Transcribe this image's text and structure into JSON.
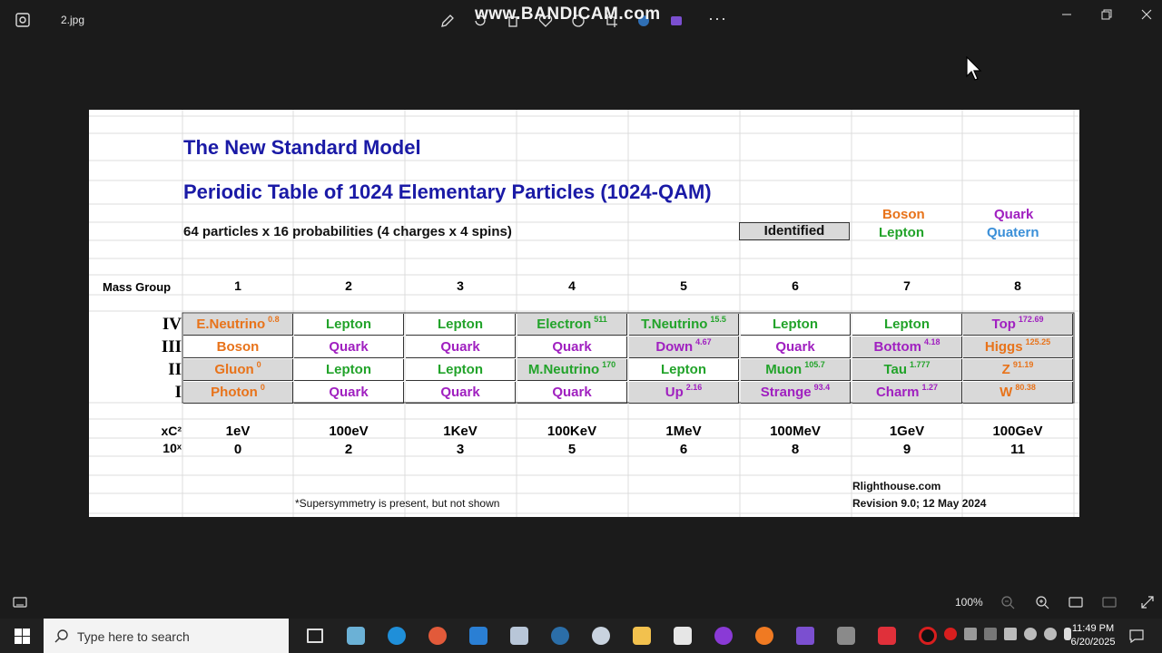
{
  "viewer": {
    "filename": "2.jpg",
    "watermark": "www.BANDICAM.com",
    "more_label": "···",
    "zoom": "100%"
  },
  "sheet": {
    "title": "The New Standard Model",
    "subtitle": "Periodic Table of 1024 Elementary Particles (1024-QAM)",
    "description": "64 particles x 16 probabilities (4 charges x 4 spins)",
    "identified_label": "Identified",
    "legend": {
      "boson": "Boson",
      "lepton": "Lepton",
      "quark": "Quark",
      "quatern": "Quatern"
    },
    "mass_group_label": "Mass Group",
    "mass_groups": [
      "1",
      "2",
      "3",
      "4",
      "5",
      "6",
      "7",
      "8"
    ],
    "generations": [
      "IV",
      "III",
      "II",
      "I"
    ],
    "rows": [
      [
        {
          "name": "E.Neutrino",
          "sup": "0.8",
          "type": "boson",
          "shade": true
        },
        {
          "name": "Lepton",
          "sup": "",
          "type": "lepton",
          "shade": false
        },
        {
          "name": "Lepton",
          "sup": "",
          "type": "lepton",
          "shade": false
        },
        {
          "name": "Electron",
          "sup": "511",
          "type": "lepton",
          "shade": true
        },
        {
          "name": "T.Neutrino",
          "sup": "15.5",
          "type": "lepton",
          "shade": true
        },
        {
          "name": "Lepton",
          "sup": "",
          "type": "lepton",
          "shade": false
        },
        {
          "name": "Lepton",
          "sup": "",
          "type": "lepton",
          "shade": false
        },
        {
          "name": "Top",
          "sup": "172.69",
          "type": "quark",
          "shade": true
        }
      ],
      [
        {
          "name": "Boson",
          "sup": "",
          "type": "boson",
          "shade": false
        },
        {
          "name": "Quark",
          "sup": "",
          "type": "quark",
          "shade": false
        },
        {
          "name": "Quark",
          "sup": "",
          "type": "quark",
          "shade": false
        },
        {
          "name": "Quark",
          "sup": "",
          "type": "quark",
          "shade": false
        },
        {
          "name": "Down",
          "sup": "4.67",
          "type": "quark",
          "shade": true
        },
        {
          "name": "Quark",
          "sup": "",
          "type": "quark",
          "shade": false
        },
        {
          "name": "Bottom",
          "sup": "4.18",
          "type": "quark",
          "shade": true
        },
        {
          "name": "Higgs",
          "sup": "125.25",
          "type": "boson",
          "shade": true
        }
      ],
      [
        {
          "name": "Gluon",
          "sup": "0",
          "type": "boson",
          "shade": true
        },
        {
          "name": "Lepton",
          "sup": "",
          "type": "lepton",
          "shade": false
        },
        {
          "name": "Lepton",
          "sup": "",
          "type": "lepton",
          "shade": false
        },
        {
          "name": "M.Neutrino",
          "sup": "170",
          "type": "lepton",
          "shade": true
        },
        {
          "name": "Lepton",
          "sup": "",
          "type": "lepton",
          "shade": false
        },
        {
          "name": "Muon",
          "sup": "105.7",
          "type": "lepton",
          "shade": true
        },
        {
          "name": "Tau",
          "sup": "1.777",
          "type": "lepton",
          "shade": true
        },
        {
          "name": "Z",
          "sup": "91.19",
          "type": "boson",
          "shade": true
        }
      ],
      [
        {
          "name": "Photon",
          "sup": "0",
          "type": "boson",
          "shade": true
        },
        {
          "name": "Quark",
          "sup": "",
          "type": "quark",
          "shade": false
        },
        {
          "name": "Quark",
          "sup": "",
          "type": "quark",
          "shade": false
        },
        {
          "name": "Quark",
          "sup": "",
          "type": "quark",
          "shade": false
        },
        {
          "name": "Up",
          "sup": "2.16",
          "type": "quark",
          "shade": true
        },
        {
          "name": "Strange",
          "sup": "93.4",
          "type": "quark",
          "shade": true
        },
        {
          "name": "Charm",
          "sup": "1.27",
          "type": "quark",
          "shade": true
        },
        {
          "name": "W",
          "sup": "80.38",
          "type": "boson",
          "shade": true
        }
      ]
    ],
    "energy_label": "xC²",
    "energies": [
      "1eV",
      "100eV",
      "1KeV",
      "100KeV",
      "1MeV",
      "100MeV",
      "1GeV",
      "100GeV"
    ],
    "exponent_label": "10ˣ",
    "exponents": [
      "0",
      "2",
      "3",
      "5",
      "6",
      "8",
      "9",
      "11"
    ],
    "footnote": "*Supersymmetry is present, but not shown",
    "site": "Rlighthouse.com",
    "revision": "Revision 9.0; 12 May 2024"
  },
  "colors": {
    "lepton": "#22a32a",
    "quark": "#a020c0",
    "boson": "#e8731a",
    "quatern": "#3a8fd8",
    "title": "#1a1aa6",
    "shade": "#d9d9d9"
  },
  "taskbar": {
    "search_placeholder": "Type here to search",
    "time": "11:49 PM",
    "date": "6/20/2025"
  }
}
